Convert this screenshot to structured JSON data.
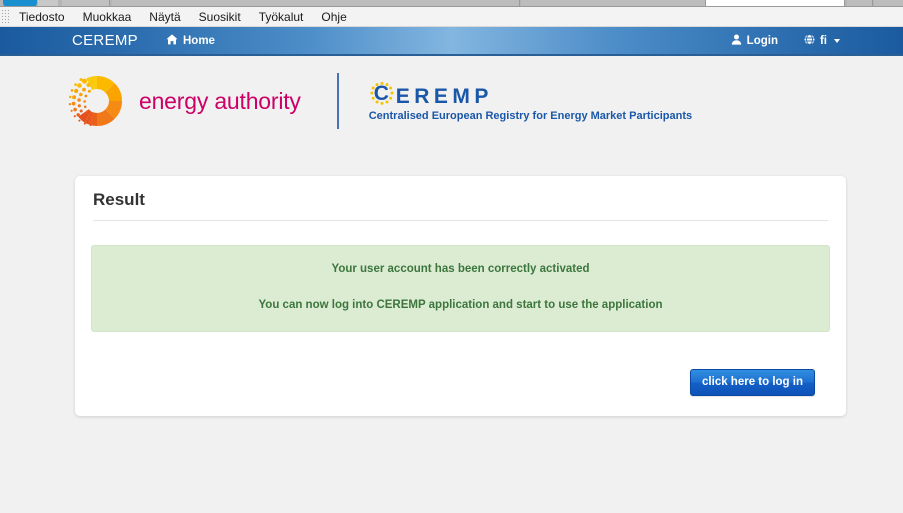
{
  "browser": {
    "menu_items": [
      "Tiedosto",
      "Muokkaa",
      "Näytä",
      "Suosikit",
      "Työkalut",
      "Ohje"
    ]
  },
  "navbar": {
    "brand": "CEREMP",
    "home_label": "Home",
    "home_icon": "home-icon",
    "login_label": "Login",
    "login_icon": "user-icon",
    "language_label": "fi",
    "language_icon": "globe-icon"
  },
  "logos": {
    "energy_authority": {
      "wordmark": "energy authority",
      "mark_icon": "dissolving-donut-logo",
      "wordmark_color": "#cc0066"
    },
    "ceremp": {
      "acronym_first_letter": "C",
      "acronym_rest": "EREMP",
      "subtitle": "Centralised European Registry for Energy Market Participants",
      "stars_icon": "eu-stars-icon",
      "color": "#1a57a8"
    }
  },
  "panel": {
    "title": "Result",
    "alert": {
      "line1": "Your user account has been correctly activated",
      "line2": "You can now log into CEREMP application and start to use the application",
      "background_color": "#dcecd3",
      "text_color": "#3c763d"
    },
    "login_button_label": "click here to log in",
    "login_button_color": "#1460c6"
  }
}
